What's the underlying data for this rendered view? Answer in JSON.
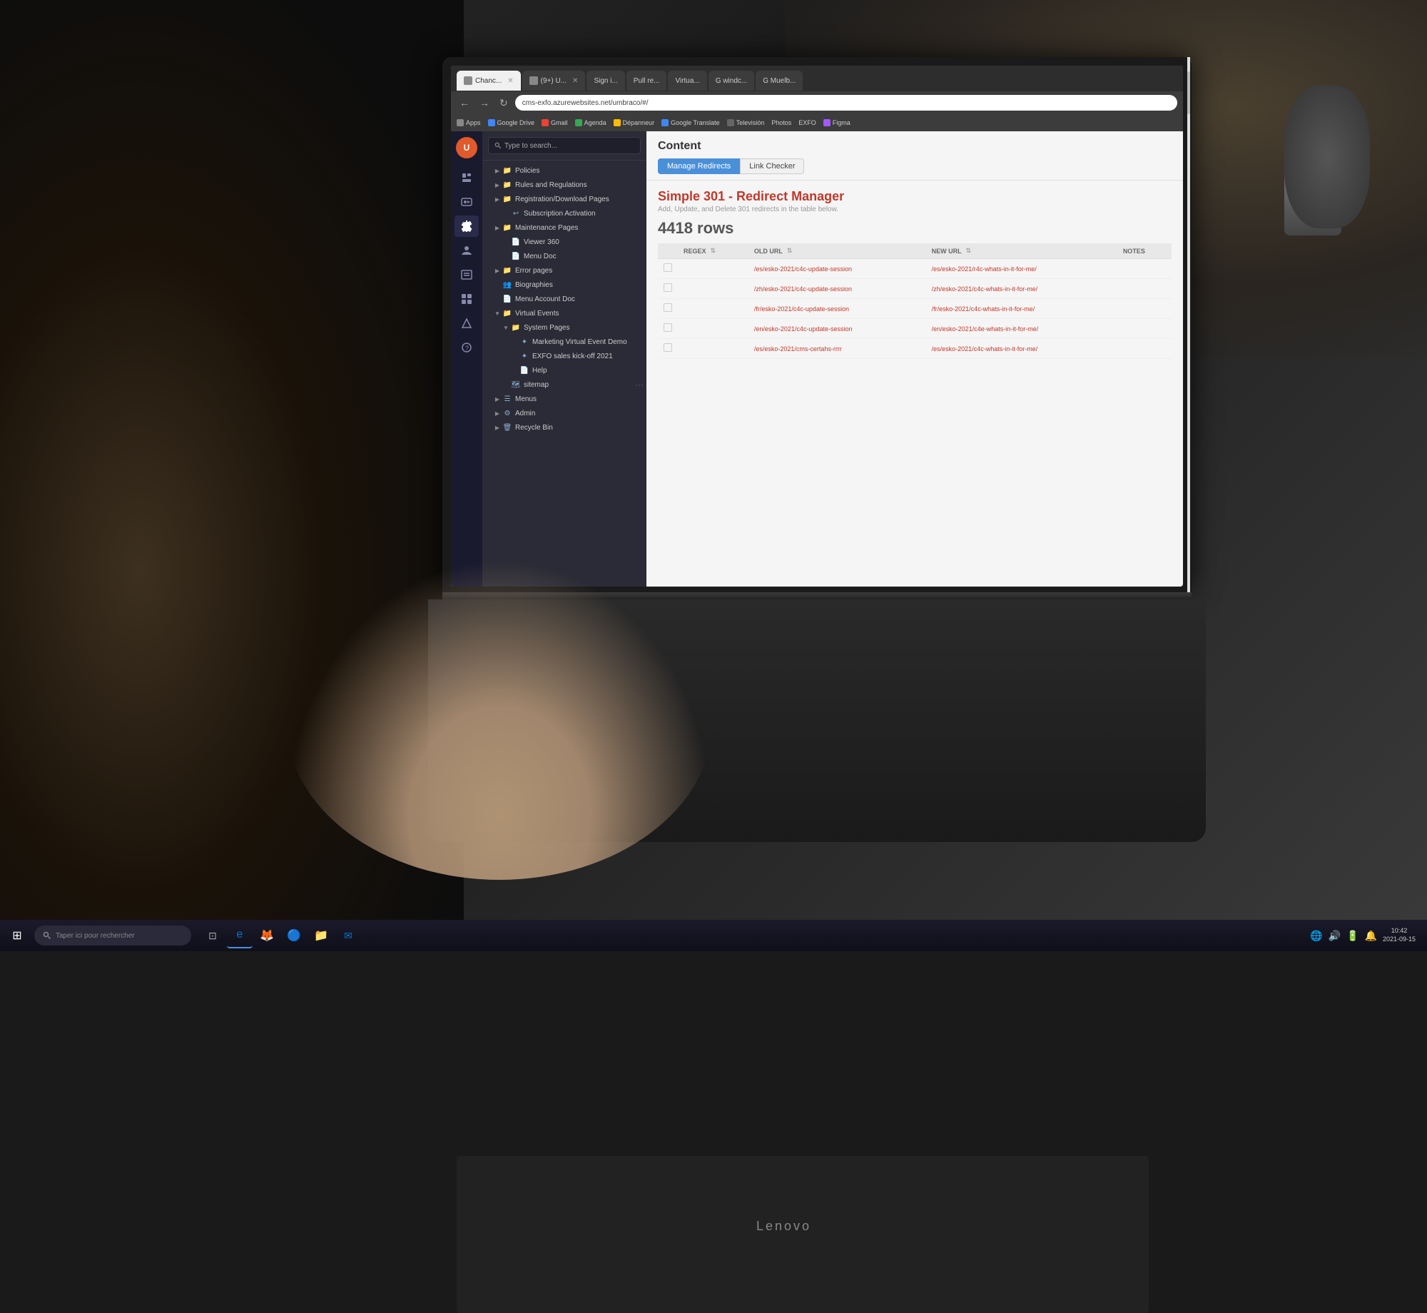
{
  "browser": {
    "address": "cms-exfo.azurewebsites.net/umbraco/#/",
    "tabs": [
      {
        "label": "Chanc...",
        "active": true
      },
      {
        "label": "(9+) U...",
        "active": false
      },
      {
        "label": "Sign i...",
        "active": false
      },
      {
        "label": "Pull re...",
        "active": false
      },
      {
        "label": "Virtua...",
        "active": false
      },
      {
        "label": "G windc...",
        "active": false
      },
      {
        "label": "G Muelb...",
        "active": false
      }
    ],
    "bookmarks": [
      "Apps",
      "Google Drive",
      "Gmail",
      "Agenda",
      "Dépanneur",
      "Google Translate",
      "Televisión",
      "Photos",
      "EXFO",
      "Figma"
    ]
  },
  "cms": {
    "logo": "U",
    "sidebar_icons": [
      "file",
      "image",
      "wrench",
      "settings",
      "person",
      "table",
      "panel",
      "arrow",
      "question"
    ],
    "search_placeholder": "Type to search...",
    "tree_items": [
      {
        "label": "Policies",
        "level": 1,
        "icon": "folder",
        "has_arrow": true
      },
      {
        "label": "Rules and Regulations",
        "level": 1,
        "icon": "folder",
        "has_arrow": true
      },
      {
        "label": "Registration/Download Pages",
        "level": 1,
        "icon": "folder",
        "has_arrow": true
      },
      {
        "label": "Subscription Activation",
        "level": 2,
        "icon": "undo",
        "has_arrow": false
      },
      {
        "label": "Maintenance Pages",
        "level": 1,
        "icon": "folder",
        "has_arrow": true
      },
      {
        "label": "Viewer 360",
        "level": 2,
        "icon": "doc",
        "has_arrow": false
      },
      {
        "label": "Menu Doc",
        "level": 2,
        "icon": "doc",
        "has_arrow": false
      },
      {
        "label": "Error pages",
        "level": 1,
        "icon": "folder",
        "has_arrow": true
      },
      {
        "label": "Biographies",
        "level": 1,
        "icon": "people",
        "has_arrow": false
      },
      {
        "label": "Menu Account Doc",
        "level": 1,
        "icon": "doc",
        "has_arrow": false
      },
      {
        "label": "Virtual Events",
        "level": 1,
        "icon": "folder",
        "has_arrow": true
      },
      {
        "label": "System Pages",
        "level": 2,
        "icon": "folder",
        "has_arrow": true
      },
      {
        "label": "Marketing Virtual Event Demo",
        "level": 3,
        "icon": "star",
        "has_arrow": false
      },
      {
        "label": "EXFO sales kick-off 2021",
        "level": 3,
        "icon": "star",
        "has_arrow": false
      },
      {
        "label": "Help",
        "level": 3,
        "icon": "doc",
        "has_arrow": false
      },
      {
        "label": "sitemap",
        "level": 2,
        "icon": "sitemap",
        "has_arrow": false,
        "has_dots": true
      },
      {
        "label": "Menus",
        "level": 1,
        "icon": "menu",
        "has_arrow": true
      },
      {
        "label": "Admin",
        "level": 1,
        "icon": "settings",
        "has_arrow": true
      },
      {
        "label": "Recycle Bin",
        "level": 1,
        "icon": "folder",
        "has_arrow": true
      }
    ]
  },
  "content": {
    "title": "Content",
    "tabs": [
      {
        "label": "Manage Redirects",
        "active": true
      },
      {
        "label": "Link Checker",
        "active": false
      }
    ],
    "redirect_title": "Simple 301 - Redirect Manager",
    "redirect_subtitle": "Add, Update, and Delete 301 redirects in the table below.",
    "rows_count": "4418 rows",
    "table": {
      "columns": [
        "REGEX",
        "OLD URL",
        "NEW URL",
        "NOTES"
      ],
      "rows": [
        {
          "regex": false,
          "old_url": "/es/esko-2021/c4c-update-session",
          "new_url": "/es/esko-2021/r4c-whats-in-it-for-me/",
          "notes": ""
        },
        {
          "regex": false,
          "old_url": "/zh/esko-2021/c4c-update-session",
          "new_url": "/zh/esko-2021/c4c-whats-in-it-for-me/",
          "notes": ""
        },
        {
          "regex": false,
          "old_url": "/fr/esko-2021/c4c-update-session",
          "new_url": "/fr/esko-2021/c4c-whats-in-it-for-me/",
          "notes": ""
        },
        {
          "regex": false,
          "old_url": "/en/esko-2021/c4c-update-session",
          "new_url": "/en/esko-2021/c4e-whats-in-it-for-me/",
          "notes": ""
        },
        {
          "regex": false,
          "old_url": "/es/esko-2021/cms-certahs-rrrr",
          "new_url": "/es/esko-2021/c4c-whats-in-it-for-me/",
          "notes": ""
        }
      ]
    }
  },
  "taskbar": {
    "search_text": "Taper ici pour rechercher",
    "lenovo_label": "Lenovo",
    "apps": [
      "⊞",
      "🔍",
      "⊡",
      "e",
      "🦊",
      "🔵",
      "📁",
      "✉"
    ]
  }
}
